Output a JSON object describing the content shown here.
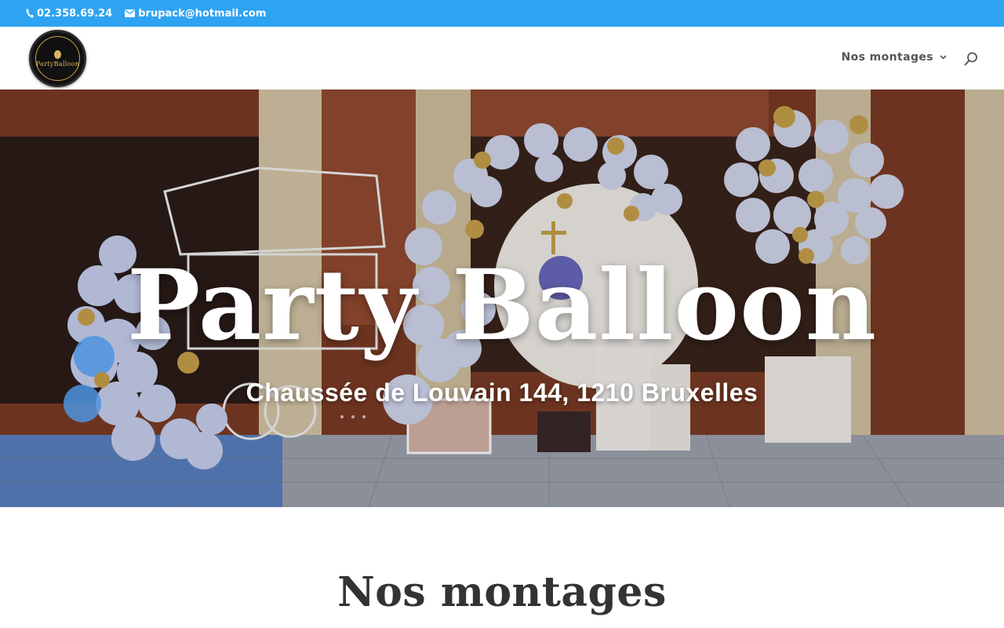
{
  "topbar": {
    "phone": "02.358.69.24",
    "email": "brupack@hotmail.com",
    "icons": {
      "phone": "phone-icon",
      "email": "envelope-icon"
    },
    "bg_color": "#2ea3f2"
  },
  "header": {
    "logo": {
      "alt": "Party Balloon logo",
      "text": "PartyBalloon",
      "icon": "balloon-icon"
    },
    "nav": [
      {
        "label": "Nos montages",
        "has_dropdown": true
      }
    ],
    "search_icon": "search-icon"
  },
  "hero": {
    "title": "Party Balloon",
    "subtitle": "Chaussée de Louvain 144, 1210 Bruxelles"
  },
  "section": {
    "title": "Nos montages"
  },
  "colors": {
    "accent": "#2ea3f2",
    "heading": "#333333",
    "nav_text": "#555555"
  }
}
